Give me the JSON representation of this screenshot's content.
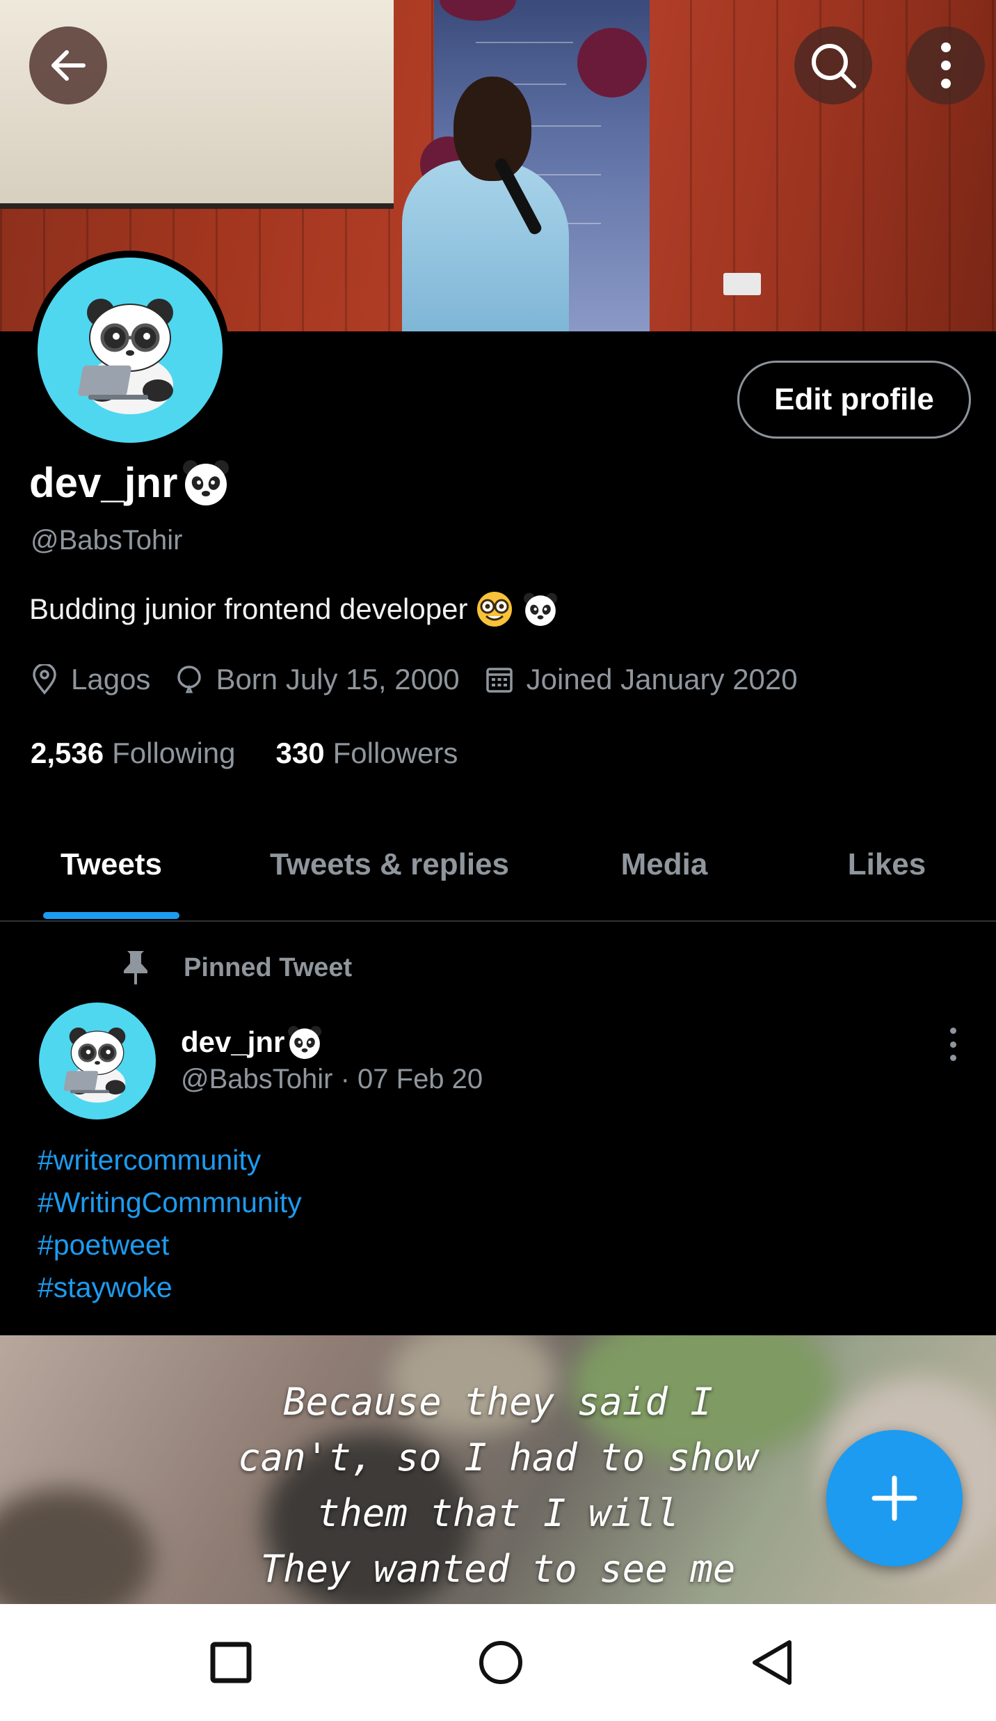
{
  "header": {
    "back_icon": "arrow-left-icon",
    "search_icon": "search-icon",
    "more_icon": "more-vertical-icon",
    "banner_alt": "profile-banner-photo"
  },
  "profile": {
    "display_name": "dev_jnr",
    "name_emoji": "panda-face-emoji",
    "handle": "@BabsTohir",
    "edit_button": "Edit profile",
    "bio": "Budding junior frontend developer",
    "bio_emojis": [
      "nerd-face-emoji",
      "panda-face-emoji"
    ],
    "location": "Lagos",
    "birthday": "Born July 15, 2000",
    "joined": "Joined January 2020",
    "following_count": "2,536",
    "following_label": "Following",
    "followers_count": "330",
    "followers_label": "Followers"
  },
  "tabs": [
    {
      "label": "Tweets",
      "active": true
    },
    {
      "label": "Tweets & replies",
      "active": false
    },
    {
      "label": "Media",
      "active": false
    },
    {
      "label": "Likes",
      "active": false
    }
  ],
  "pinned_tweet": {
    "pinned_label": "Pinned Tweet",
    "author_name": "dev_jnr",
    "author_handle_date": "@BabsTohir · 07 Feb 20",
    "hashtags": [
      "#writercommunity",
      "#WritingCommnunity",
      "#poetweet",
      "#staywoke"
    ],
    "image_text": "Because they said I\ncan't, so I had to show\nthem that I will\nThey wanted to see me"
  },
  "fab": {
    "icon": "plus-icon"
  },
  "system_nav": {
    "recents_icon": "square-recents-icon",
    "home_icon": "circle-home-icon",
    "back_icon": "triangle-back-icon"
  },
  "colors": {
    "accent": "#1d9bf0",
    "background": "#000000",
    "secondary_text": "#8f969d",
    "avatar_bg": "#4fd7f0"
  }
}
